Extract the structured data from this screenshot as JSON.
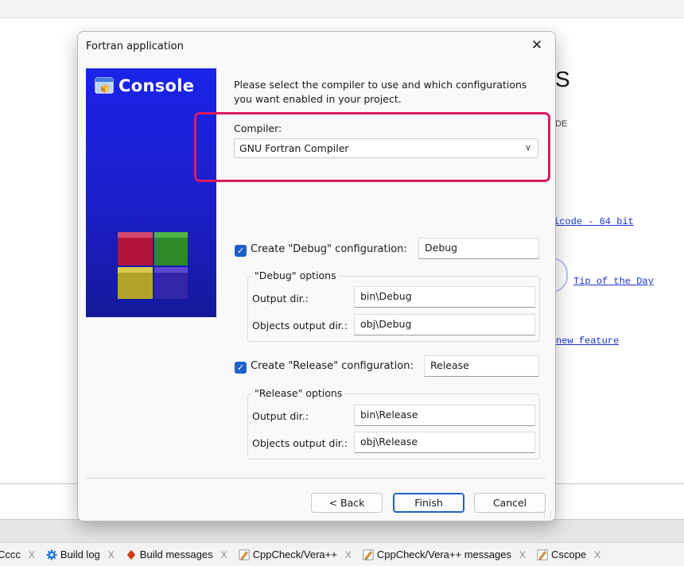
{
  "background": {
    "title_fragment": "S",
    "subtitle_fragment": "DE",
    "links": [
      "icode - 64 bit",
      "Tip of the Day",
      "new feature"
    ],
    "bottom_tabs": [
      {
        "label": "Cccc",
        "icon": "none"
      },
      {
        "label": "Build log",
        "icon": "gear-icon"
      },
      {
        "label": "Build messages",
        "icon": "diamond-icon"
      },
      {
        "label": "CppCheck/Vera++",
        "icon": "pencil-icon"
      },
      {
        "label": "CppCheck/Vera++ messages",
        "icon": "pencil-icon"
      },
      {
        "label": "Cscope",
        "icon": "pencil-icon"
      }
    ],
    "tab_close_glyph": "X"
  },
  "dialog": {
    "title": "Fortran application",
    "close_glyph": "✕",
    "side_logo": "Console",
    "intro": "Please select the compiler to use and which configurations you want enabled in your project.",
    "compiler": {
      "label": "Compiler:",
      "value": "GNU Fortran Compiler"
    },
    "debug": {
      "checkbox_label": "Create \"Debug\" configuration:",
      "checked": true,
      "name": "Debug",
      "group_title": "\"Debug\" options",
      "output_dir_label": "Output dir.:",
      "output_dir": "bin\\Debug",
      "objects_dir_label": "Objects output dir.:",
      "objects_dir": "obj\\Debug"
    },
    "release": {
      "checkbox_label": "Create \"Release\" configuration:",
      "checked": true,
      "name": "Release",
      "group_title": "\"Release\" options",
      "output_dir_label": "Output dir.:",
      "output_dir": "bin\\Release",
      "objects_dir_label": "Objects output dir.:",
      "objects_dir": "obj\\Release"
    },
    "buttons": {
      "back": "< Back",
      "finish": "Finish",
      "cancel": "Cancel"
    }
  },
  "colors": {
    "highlight": "#d81b62",
    "accent": "#1f60c6",
    "side_panel": "#1c1ec9",
    "link": "#1a33cc"
  }
}
